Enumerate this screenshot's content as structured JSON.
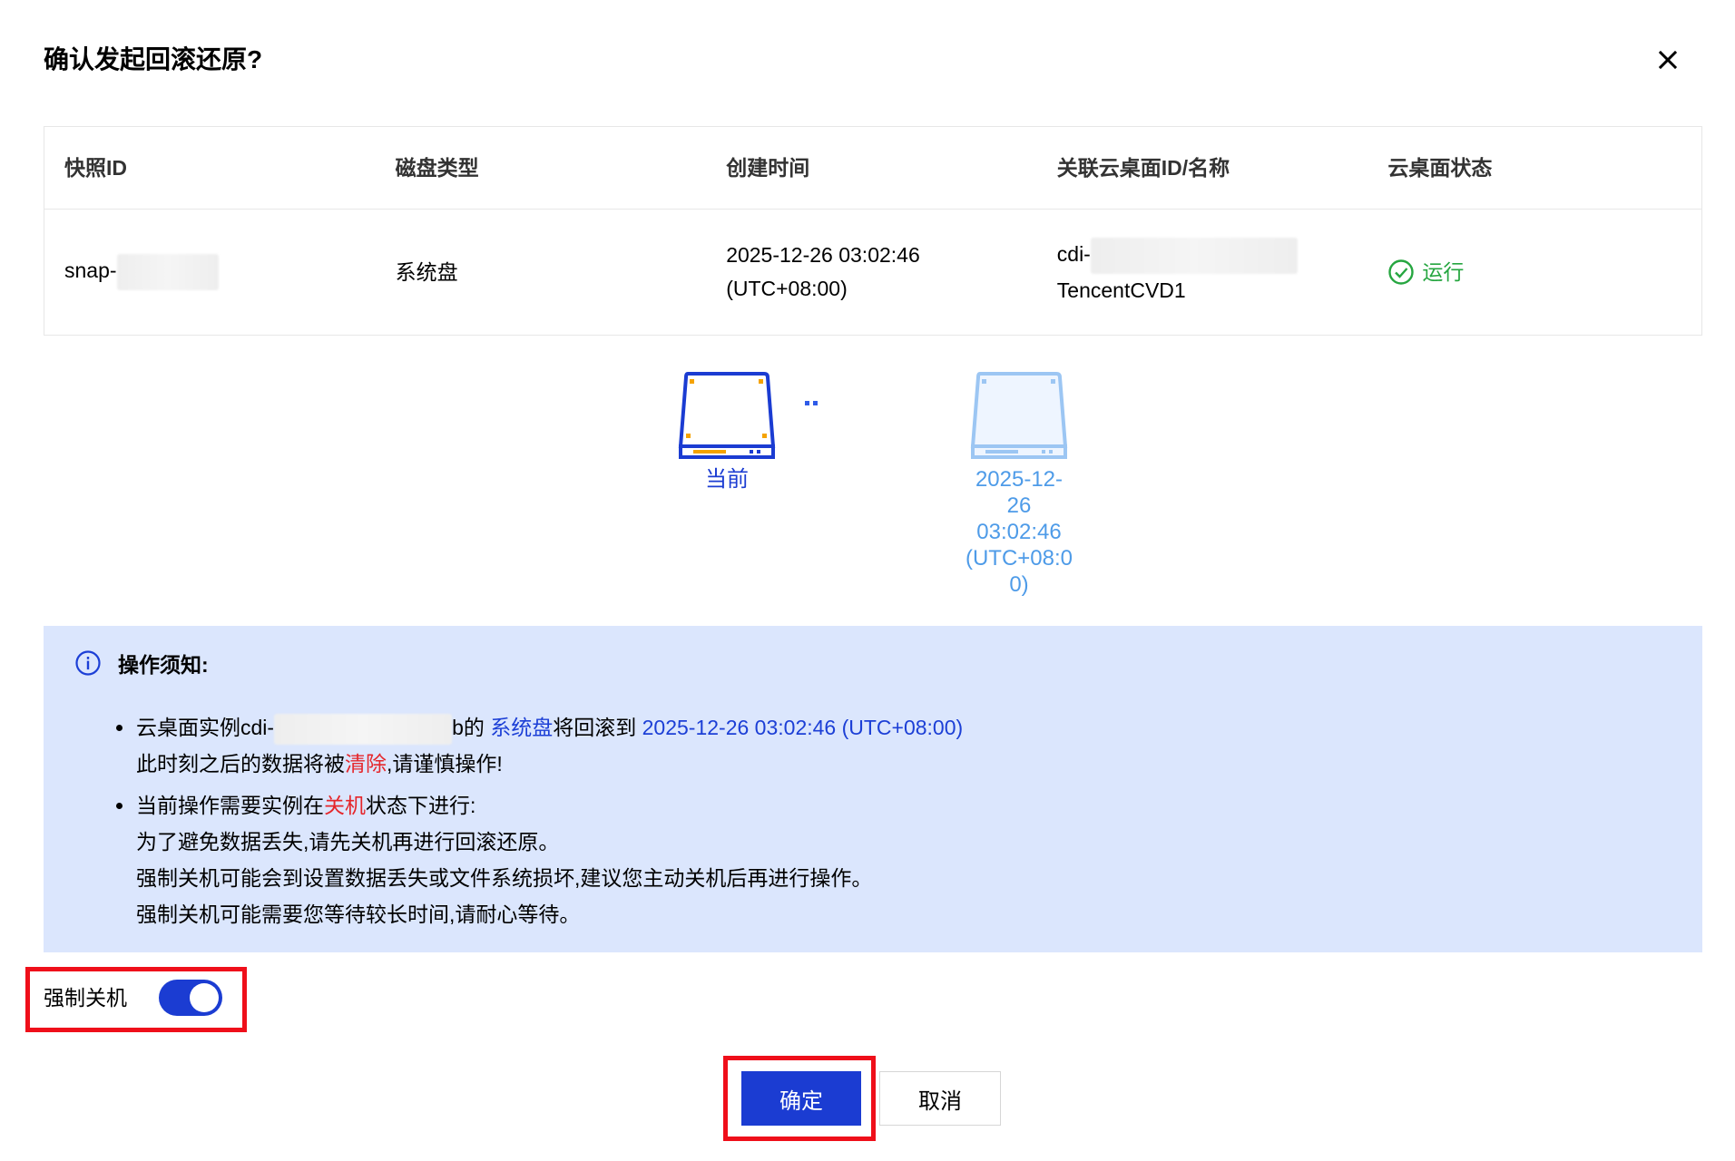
{
  "dialog": {
    "title": "确认发起回滚还原?"
  },
  "table": {
    "headers": [
      "快照ID",
      "磁盘类型",
      "创建时间",
      "关联云桌面ID/名称",
      "云桌面状态"
    ],
    "row": {
      "snapshot_id_prefix": "snap-",
      "disk_type": "系统盘",
      "created_line1": "2025-12-26 03:02:46",
      "created_line2": "(UTC+08:00)",
      "desktop_id_prefix": "cdi-",
      "desktop_name": "TencentCVD1",
      "status": "运行"
    }
  },
  "disks": {
    "current_label": "当前",
    "target_label_lines": [
      "2025-12-",
      "26",
      "03:02:46",
      "(UTC+08:0",
      "0)"
    ]
  },
  "notice": {
    "title": "操作须知:",
    "item1": {
      "part1": "云桌面实例cdi-",
      "part2": "b的 ",
      "disk_link": "系统盘",
      "part3": "将回滚到 ",
      "time_link": "2025-12-26 03:02:46 (UTC+08:00)",
      "line2_part1": "此时刻之后的数据将被",
      "line2_red": "清除",
      "line2_part2": ",请谨慎操作!"
    },
    "item2": {
      "part1": "当前操作需要实例在",
      "red": "关机",
      "part2": "状态下进行:",
      "line2": "为了避免数据丢失,请先关机再进行回滚还原。",
      "line3": "强制关机可能会到设置数据丢失或文件系统损坏,建议您主动关机后再进行操作。",
      "line4": "强制关机可能需要您等待较长时间,请耐心等待。"
    }
  },
  "force_shutdown": {
    "label": "强制关机",
    "enabled": true
  },
  "buttons": {
    "confirm": "确定",
    "cancel": "取消"
  },
  "colors": {
    "primary": "#1b3cd2",
    "link": "#1c3fd6",
    "danger": "#e5262b",
    "success": "#26a640",
    "notice_bg": "#dbe6fd",
    "highlight_border": "#ef0f1a"
  }
}
